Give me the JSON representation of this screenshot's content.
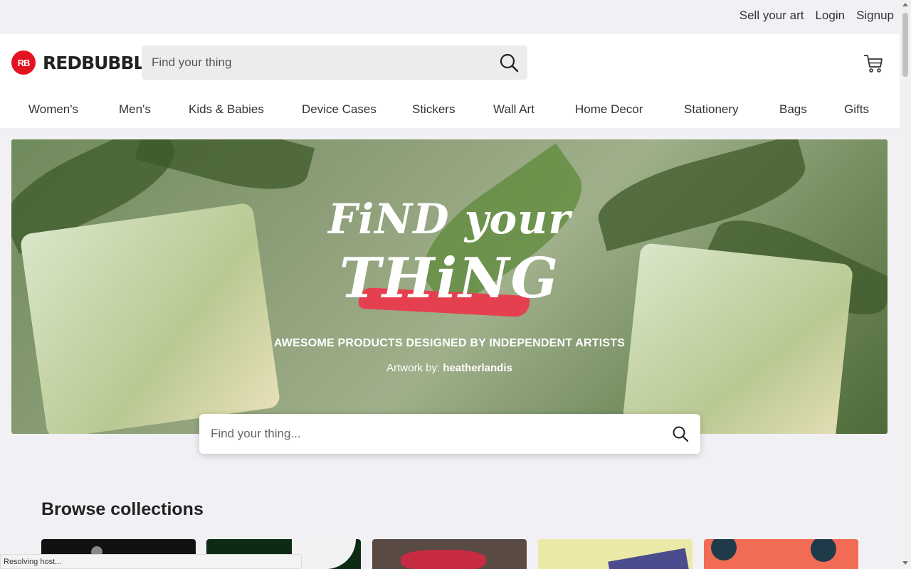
{
  "topbar": {
    "links": [
      "Sell your art",
      "Login",
      "Signup"
    ]
  },
  "brand": {
    "badge": "RB",
    "name": "REDBUBBLE",
    "color": "#e41321"
  },
  "header_search": {
    "placeholder": "Find your thing",
    "icon": "search-icon"
  },
  "cart": {
    "icon": "cart-icon"
  },
  "nav": [
    "Women's",
    "Men's",
    "Kids & Babies",
    "Device Cases",
    "Stickers",
    "Wall Art",
    "Home Decor",
    "Stationery",
    "Bags",
    "Gifts"
  ],
  "hero": {
    "line1": "FiND your",
    "line2": "THiNG",
    "tagline": "AWESOME PRODUCTS DESIGNED BY INDEPENDENT ARTISTS",
    "artwork_label": "Artwork by:",
    "artist": "heatherlandis",
    "accent": "#e5404f"
  },
  "hero_search": {
    "placeholder": "Find your thing...",
    "icon": "search-icon"
  },
  "browse": {
    "title": "Browse collections"
  },
  "status_bar": "Resolving host..."
}
